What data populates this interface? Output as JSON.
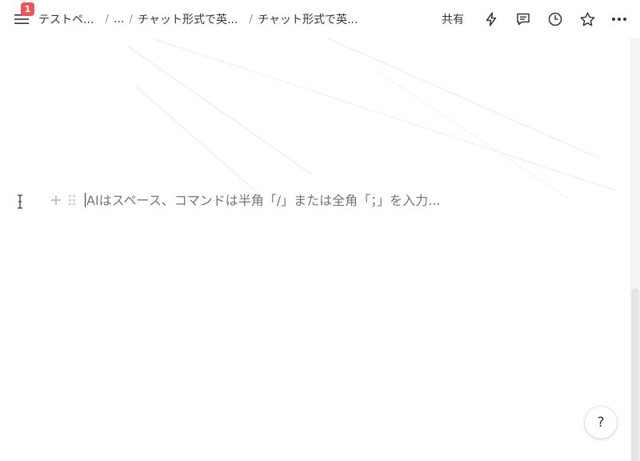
{
  "topbar": {
    "notification_count": "1",
    "breadcrumbs": [
      "テストペ...",
      "...",
      "チャット形式で英...",
      "チャット形式で英..."
    ],
    "separator": "/",
    "share_label": "共有"
  },
  "editor": {
    "placeholder": "AIはスペース、コマンドは半角「/」または全角「；」を入力..."
  },
  "help": {
    "label": "?"
  },
  "icons": {
    "menu": "menu-icon",
    "updates": "lightning-icon",
    "comments": "comment-icon",
    "history": "clock-icon",
    "favorite": "star-icon",
    "more": "more-icon",
    "add_block": "plus-icon",
    "drag": "drag-handle-icon",
    "text_cursor": "ibeam-cursor-icon"
  },
  "colors": {
    "badge": "#eb5757",
    "text": "#37352f",
    "placeholder": "#a5a4a0",
    "icon_muted": "#c7c6c4"
  }
}
